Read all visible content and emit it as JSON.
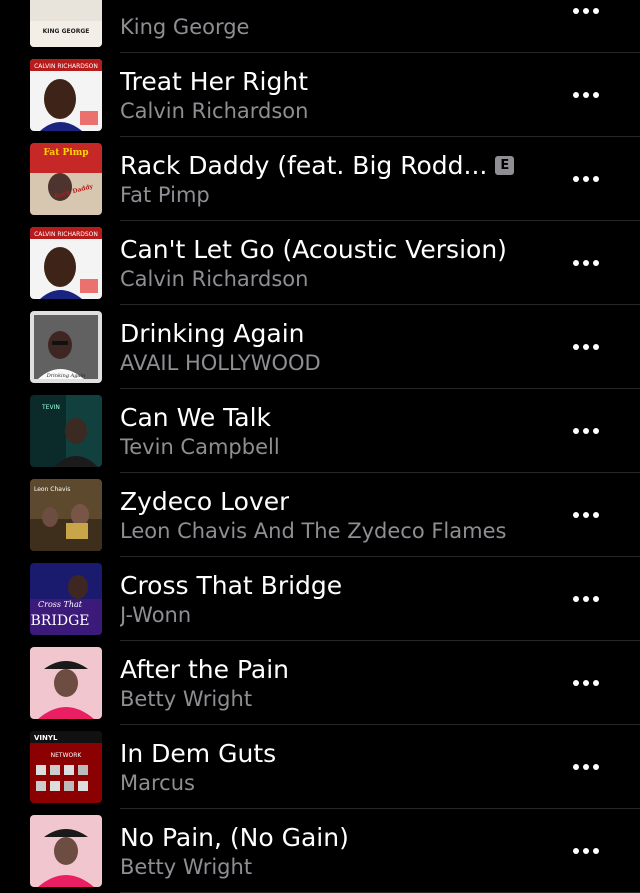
{
  "songs": [
    {
      "title": "",
      "artist": "King George",
      "explicit": false
    },
    {
      "title": "Treat Her Right",
      "artist": "Calvin Richardson",
      "explicit": false
    },
    {
      "title": "Rack Daddy (feat. Big Rodd...",
      "artist": "Fat Pimp",
      "explicit": true,
      "explicit_label": "E"
    },
    {
      "title": "Can't Let Go (Acoustic Version)",
      "artist": "Calvin Richardson",
      "explicit": false
    },
    {
      "title": "Drinking Again",
      "artist": "AVAIL HOLLYWOOD",
      "explicit": false
    },
    {
      "title": "Can We Talk",
      "artist": "Tevin Campbell",
      "explicit": false
    },
    {
      "title": "Zydeco Lover",
      "artist": "Leon Chavis And The Zydeco Flames",
      "explicit": false
    },
    {
      "title": "Cross That Bridge",
      "artist": "J-Wonn",
      "explicit": false
    },
    {
      "title": "After the Pain",
      "artist": "Betty Wright",
      "explicit": false
    },
    {
      "title": "In Dem Guts",
      "artist": "Marcus",
      "explicit": false
    },
    {
      "title": "No Pain, (No Gain)",
      "artist": "Betty Wright",
      "explicit": false
    }
  ],
  "artwork_text": {
    "king_george": "KING GEORGE",
    "calvin": "CALVIN RICHARDSON",
    "fat_pimp": "Fat Pimp",
    "fat_pimp_sub": "Rack Daddy",
    "drinking_again": "Drinking Again",
    "tevin": "TEVIN",
    "leon": "Leon Chavis",
    "jwonn_1": "Cross That",
    "jwonn_2": "BRIDGE",
    "vinyl": "VINYL",
    "network": "NETWORK"
  },
  "colors": {
    "background": "#000000",
    "title": "#ffffff",
    "subtitle": "#8e8e93",
    "separator": "#262626"
  }
}
